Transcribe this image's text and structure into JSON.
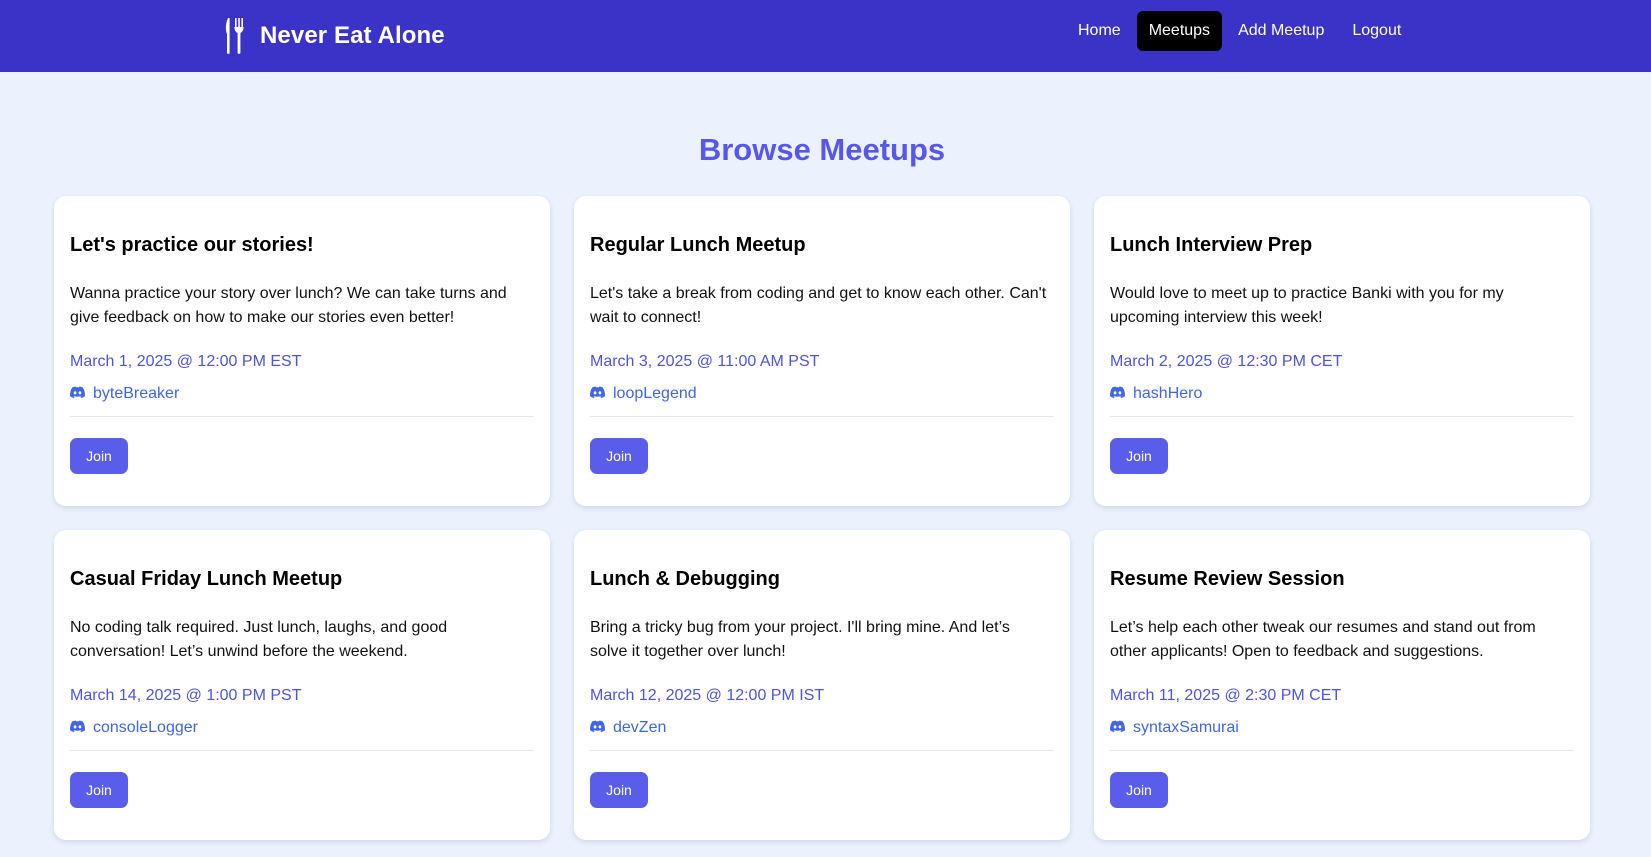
{
  "header": {
    "brand_icon": "fork-knife-icon",
    "brand_title": "Never Eat Alone",
    "nav": [
      {
        "label": "Home",
        "active": false
      },
      {
        "label": "Meetups",
        "active": true
      },
      {
        "label": "Add Meetup",
        "active": false
      },
      {
        "label": "Logout",
        "active": false
      }
    ]
  },
  "main": {
    "title": "Browse Meetups",
    "host_icon": "discord-icon",
    "meetups": [
      {
        "title": "Let's practice our stories!",
        "description": "Wanna practice your story over lunch? We can take turns and give feedback on how to make our stories even better!",
        "datetime": "March 1, 2025 @ 12:00 PM EST",
        "host": "byteBreaker",
        "join_label": "Join"
      },
      {
        "title": "Regular Lunch Meetup",
        "description": "Let's take a break from coding and get to know each other. Can't wait to connect!",
        "datetime": "March 3, 2025 @ 11:00 AM PST",
        "host": "loopLegend",
        "join_label": "Join"
      },
      {
        "title": "Lunch Interview Prep",
        "description": "Would love to meet up to practice Banki with you for my upcoming interview this week!",
        "datetime": "March 2, 2025 @ 12:30 PM CET",
        "host": "hashHero",
        "join_label": "Join"
      },
      {
        "title": "Casual Friday Lunch Meetup",
        "description": "No coding talk required. Just lunch, laughs, and good conversation! Let’s unwind before the weekend.",
        "datetime": "March 14, 2025 @ 1:00 PM PST",
        "host": "consoleLogger",
        "join_label": "Join"
      },
      {
        "title": "Lunch & Debugging",
        "description": "Bring a tricky bug from your project. I'll bring mine. And let’s solve it together over lunch!",
        "datetime": "March 12, 2025 @ 12:00 PM IST",
        "host": "devZen",
        "join_label": "Join"
      },
      {
        "title": "Resume Review Session",
        "description": "Let’s help each other tweak our resumes and stand out from other applicants! Open to feedback and suggestions.",
        "datetime": "March 11, 2025 @ 2:30 PM CET",
        "host": "syntaxSamurai",
        "join_label": "Join"
      }
    ]
  },
  "colors": {
    "navbar": "#3b32c8",
    "page_background": "#ebf2fe",
    "accent": "#5a5de9",
    "title": "#5757ec",
    "link": "#3f66e8"
  }
}
